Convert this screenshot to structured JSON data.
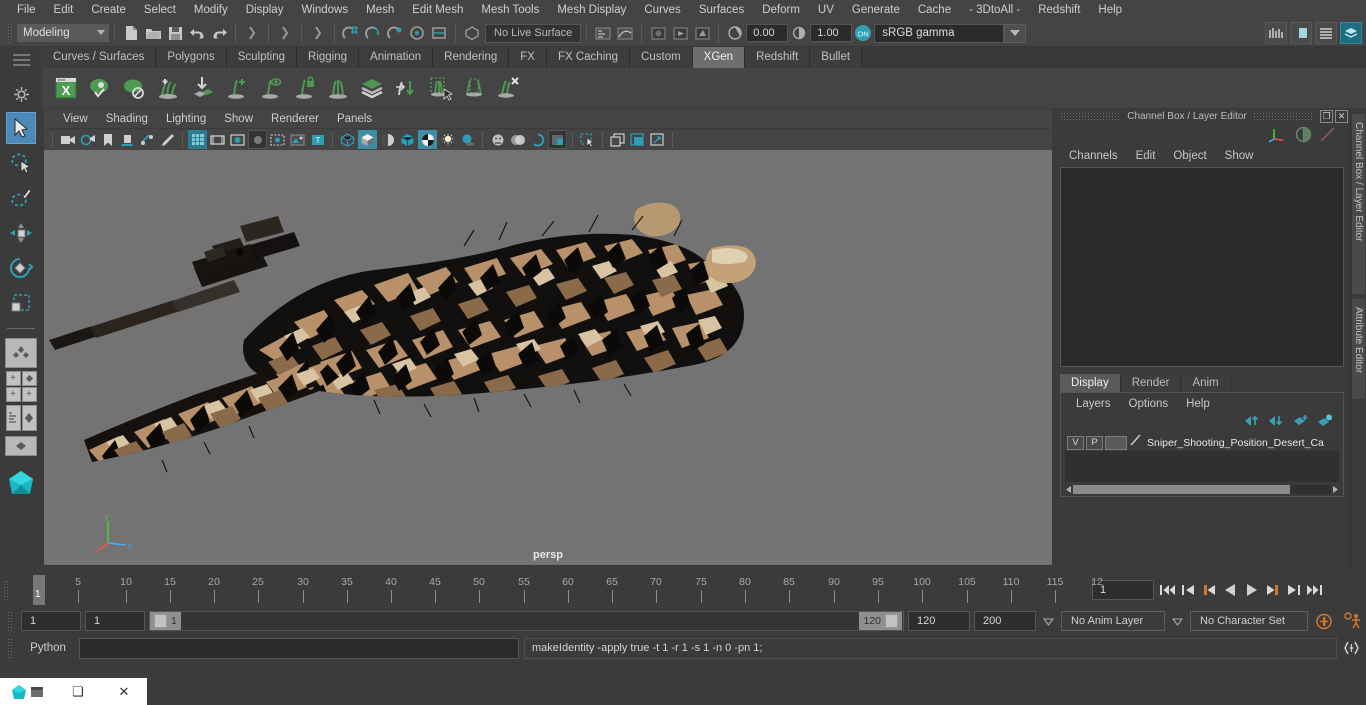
{
  "app": {
    "menubar": [
      "File",
      "Edit",
      "Create",
      "Select",
      "Modify",
      "Display",
      "Windows",
      "Mesh",
      "Edit Mesh",
      "Mesh Tools",
      "Mesh Display",
      "Curves",
      "Surfaces",
      "Deform",
      "UV",
      "Generate",
      "Cache",
      "- 3DtoAll -",
      "Redshift",
      "Help"
    ]
  },
  "statusline": {
    "menuset": "Modeling",
    "live_surface": "No Live Surface",
    "exposure_value": "0.00",
    "gamma_value": "1.00",
    "color_mgmt_toggle": "ON",
    "color_profile": "sRGB gamma"
  },
  "shelf": {
    "tabs": [
      "Curves / Surfaces",
      "Polygons",
      "Sculpting",
      "Rigging",
      "Animation",
      "Rendering",
      "FX",
      "FX Caching",
      "Custom",
      "XGen",
      "Redshift",
      "Bullet"
    ],
    "active_tab": "XGen",
    "icons": [
      "xgen-window-icon",
      "xgen-preview-icon",
      "xgen-disable-preview-icon",
      "xgen-add-description-icon",
      "xgen-import-collection-icon",
      "xgen-add-primitive-icon",
      "xgen-preview-primitive-icon",
      "xgen-lock-primitive-icon",
      "xgen-guides-icon",
      "xgen-layers-icon",
      "xgen-convert-icon",
      "xgen-select-region-icon",
      "xgen-clip-region-icon",
      "xgen-delete-primitive-icon"
    ]
  },
  "toolbox": {
    "items": [
      "select-tool",
      "lasso-select-tool",
      "paint-select-tool",
      "move-tool",
      "rotate-tool",
      "scale-tool",
      "last-tool-used",
      "snap-grid-toggle",
      "snap-curve-toggle",
      "render-view-icon",
      "render-settings-icon",
      "hypershade-icon",
      "outliner-icon",
      "maya-logo-icon"
    ],
    "active": "select-tool"
  },
  "viewport": {
    "menus": [
      "View",
      "Shading",
      "Lighting",
      "Show",
      "Renderer",
      "Panels"
    ],
    "camera_label": "persp",
    "toolbar_icons": [
      "select-camera-icon",
      "camera-attributes-icon",
      "bookmark-icon",
      "image-plane-icon",
      "twopoint-icon",
      "grease-pencil-icon",
      "grid-toggle-icon",
      "film-gate-icon",
      "resolution-gate-icon",
      "gate-mask-icon",
      "exposure-icon",
      "film-origin-icon",
      "text-overlay-icon",
      "wireframe-icon",
      "smooth-shade-icon",
      "shaded-wireframe-icon",
      "hardware-texture-icon",
      "use-default-material-icon",
      "lighting-icon",
      "shadows-icon",
      "xray-icon",
      "xray-joints-icon",
      "xray-active-icon",
      "grid-snap-icon",
      "isolate-select-icon",
      "render-region-icon",
      "ipr-render-icon",
      "render-settings-icon"
    ]
  },
  "channelbox": {
    "panel_title": "Channel Box / Layer Editor",
    "menus": [
      "Channels",
      "Edit",
      "Object",
      "Show"
    ],
    "side_tabs": [
      "Channel Box / Layer Editor",
      "Attribute Editor"
    ],
    "window_buttons": [
      "restore-icon",
      "close-icon"
    ]
  },
  "layereditor": {
    "tabs": [
      "Display",
      "Render",
      "Anim"
    ],
    "active_tab": "Display",
    "menus": [
      "Layers",
      "Options",
      "Help"
    ],
    "toolbar_icons": [
      "move-layer-up-icon",
      "move-layer-down-icon",
      "new-layer-icon",
      "new-layer-from-selected-icon"
    ],
    "layers": [
      {
        "visible": "V",
        "playback": "P",
        "color": "",
        "name": "Sniper_Shooting_Position_Desert_Ca"
      }
    ]
  },
  "timeline": {
    "ticks": [
      "5",
      "10",
      "15",
      "20",
      "25",
      "30",
      "35",
      "40",
      "45",
      "50",
      "55",
      "60",
      "65",
      "70",
      "75",
      "80",
      "85",
      "90",
      "95",
      "100",
      "105",
      "110",
      "115",
      "12"
    ],
    "current_frame_marker": "1",
    "current_frame_field": "1",
    "playback_buttons": [
      "go-to-start-icon",
      "step-back-keyframe-icon",
      "step-back-frame-icon",
      "play-backwards-icon",
      "play-forwards-icon",
      "step-forward-frame-icon",
      "step-forward-keyframe-icon",
      "go-to-end-icon"
    ]
  },
  "rangeslider": {
    "anim_start": "1",
    "range_start": "1",
    "slider_start_label": "1",
    "slider_end_label": "120",
    "range_end": "120",
    "anim_end": "200",
    "anim_layer": "No Anim Layer",
    "character_set": "No Character Set",
    "right_icons": [
      "animation-preferences-icon",
      "character-set-icon"
    ]
  },
  "commandline": {
    "language_label": "Python",
    "input_value": "",
    "output_text": "makeIdentity -apply true -t 1 -r 1 -s 1 -n 0 -pn 1;",
    "expand_icon": "script-editor-icon"
  },
  "taskbar": {
    "items": [
      "app-icon",
      "window-icon",
      "close-icon"
    ]
  },
  "colors": {
    "accent_teal": "#2d8fa8",
    "select_blue": "#4a89b8",
    "shelf_green": "#4e9a52",
    "background": "#3b3b3b",
    "viewport_bg": "#737373",
    "orange": "#d4762a"
  }
}
